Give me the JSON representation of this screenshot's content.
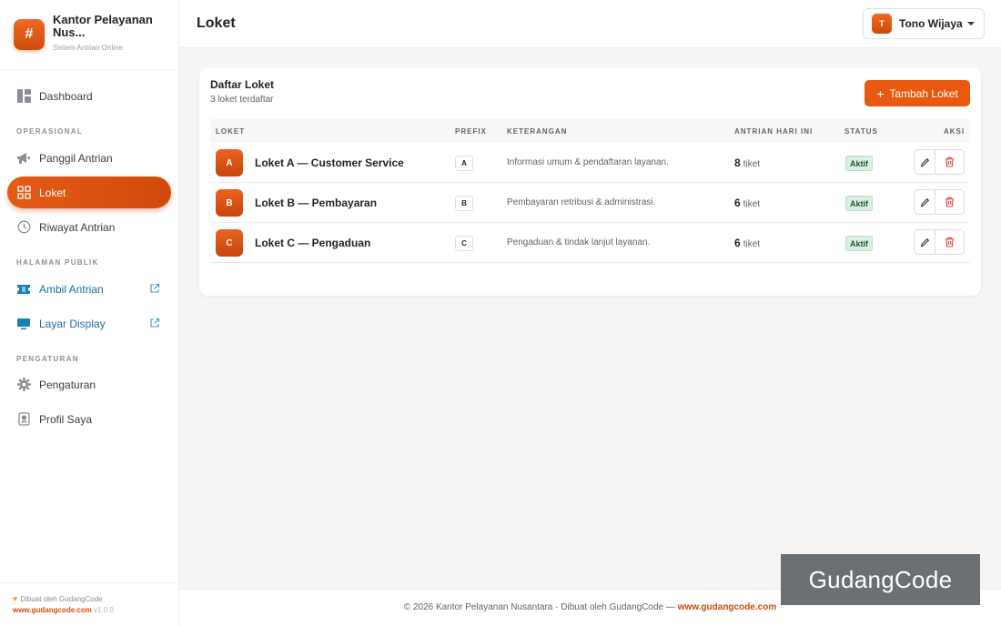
{
  "brand": {
    "logo_symbol": "#",
    "title": "Kantor Pelayanan Nus...",
    "subtitle": "Sistem Antrian Online"
  },
  "sidebar": {
    "dashboard": "Dashboard",
    "section_operasional": "OPERASIONAL",
    "panggil_antrian": "Panggil Antrian",
    "loket": "Loket",
    "riwayat_antrian": "Riwayat Antrian",
    "section_halaman_publik": "HALAMAN PUBLIK",
    "ambil_antrian": "Ambil Antrian",
    "layar_display": "Layar Display",
    "section_pengaturan": "PENGATURAN",
    "pengaturan": "Pengaturan",
    "profil_saya": "Profil Saya"
  },
  "sidebar_footer": {
    "made_by": "Dibuat oleh GudangCode",
    "site": "www.gudangcode.com",
    "version": "v1.0.0"
  },
  "header": {
    "title": "Loket",
    "user_initial": "T",
    "user_name": "Tono Wijaya"
  },
  "card": {
    "title": "Daftar Loket",
    "subtitle": "3 loket terdaftar",
    "add_button": "Tambah Loket"
  },
  "table": {
    "headers": {
      "loket": "LOKET",
      "prefix": "PREFIX",
      "keterangan": "KETERANGAN",
      "antrian": "ANTRIAN HARI INI",
      "status": "STATUS",
      "aksi": "AKSI"
    },
    "rows": [
      {
        "letter": "A",
        "name": "Loket A — Customer Service",
        "prefix": "A",
        "desc": "Informasi umum & pendaftaran layanan.",
        "count": "8",
        "unit": "tiket",
        "status": "Aktif"
      },
      {
        "letter": "B",
        "name": "Loket B — Pembayaran",
        "prefix": "B",
        "desc": "Pembayaran retribusi & administrasi.",
        "count": "6",
        "unit": "tiket",
        "status": "Aktif"
      },
      {
        "letter": "C",
        "name": "Loket C — Pengaduan",
        "prefix": "C",
        "desc": "Pengaduan & tindak lanjut layanan.",
        "count": "6",
        "unit": "tiket",
        "status": "Aktif"
      }
    ]
  },
  "footer": {
    "text": "© 2026 Kantor Pelayanan Nusantara · Dibuat oleh GudangCode — ",
    "link": "www.gudangcode.com"
  },
  "watermark": "GudangCode",
  "colors": {
    "accent": "#e8580f",
    "public_link": "#1b6fa0",
    "status_bg": "#dcefe2",
    "delete": "#e0473b"
  }
}
